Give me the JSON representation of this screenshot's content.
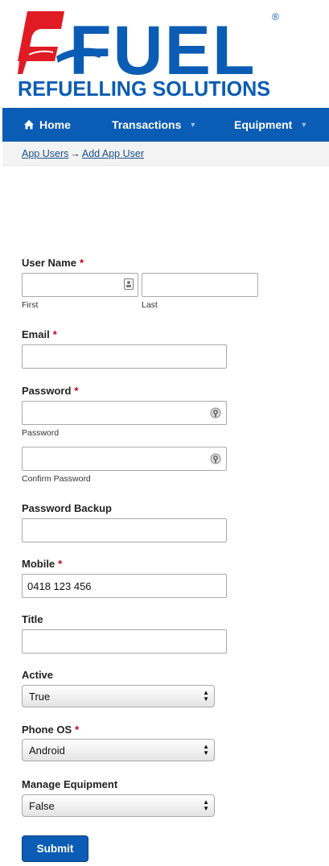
{
  "logo": {
    "wordmark": "FUEL",
    "tagline": "REFUELLING SOLUTIONS",
    "registered": "®"
  },
  "nav": {
    "items": [
      {
        "label": "Home",
        "icon": "home-icon"
      },
      {
        "label": "Transactions",
        "icon": "caret-down-icon"
      },
      {
        "label": "Equipment",
        "icon": "caret-down-icon"
      }
    ]
  },
  "breadcrumb": {
    "items": [
      "App Users",
      "Add App User"
    ],
    "separator": "→"
  },
  "form": {
    "username": {
      "label": "User Name",
      "required": "*",
      "first_label": "First",
      "last_label": "Last",
      "first_value": "",
      "last_value": ""
    },
    "email": {
      "label": "Email",
      "required": "*",
      "value": ""
    },
    "password": {
      "label": "Password",
      "required": "*",
      "sub_label": "Password",
      "confirm_label": "Confirm Password",
      "value": "",
      "confirm_value": ""
    },
    "password_backup": {
      "label": "Password Backup",
      "value": ""
    },
    "mobile": {
      "label": "Mobile",
      "required": "*",
      "value": "0418 123 456"
    },
    "title": {
      "label": "Title",
      "value": ""
    },
    "active": {
      "label": "Active",
      "selected": "True"
    },
    "phone_os": {
      "label": "Phone OS",
      "required": "*",
      "selected": "Android"
    },
    "manage_equipment": {
      "label": "Manage Equipment",
      "selected": "False"
    },
    "submit_label": "Submit"
  },
  "colors": {
    "brand_blue": "#0a5cb4",
    "brand_red": "#e01b24",
    "required_red": "#c0001a"
  }
}
